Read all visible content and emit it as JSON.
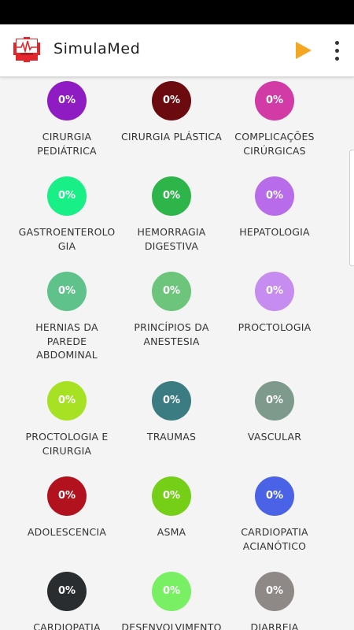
{
  "app": {
    "title": "SimulaMed"
  },
  "toolbar": {
    "play_icon": "play-icon",
    "menu_icon": "overflow-menu-icon"
  },
  "colors": {
    "accent": "#f5a623",
    "logo_red": "#e3262b"
  },
  "topics": [
    {
      "percent": "0%",
      "label": "CIRURGIA PEDIÁTRICA",
      "color": "#8e1cc2"
    },
    {
      "percent": "0%",
      "label": "CIRURGIA PLÁSTICA",
      "color": "#6b0a0f"
    },
    {
      "percent": "0%",
      "label": "COMPLICAÇÕES CIRÚRGICAS",
      "color": "#d23aa6"
    },
    {
      "percent": "0%",
      "label": "GASTROENTEROLOGIA",
      "color": "#18ef86"
    },
    {
      "percent": "0%",
      "label": "HEMORRAGIA DIGESTIVA",
      "color": "#2eb549"
    },
    {
      "percent": "0%",
      "label": "HEPATOLOGIA",
      "color": "#b86cea"
    },
    {
      "percent": "0%",
      "label": "HERNIAS DA PAREDE ABDOMINAL",
      "color": "#5ec28a"
    },
    {
      "percent": "0%",
      "label": "PRINCÍPIOS DA ANESTESIA",
      "color": "#6dc57c"
    },
    {
      "percent": "0%",
      "label": "PROCTOLOGIA",
      "color": "#c68cef"
    },
    {
      "percent": "0%",
      "label": "PROCTOLOGIA E CIRURGIA",
      "color": "#a6e123"
    },
    {
      "percent": "0%",
      "label": "TRAUMAS",
      "color": "#3b7c82"
    },
    {
      "percent": "0%",
      "label": "VASCULAR",
      "color": "#7d9a8c"
    },
    {
      "percent": "0%",
      "label": "ADOLESCENCIA",
      "color": "#b1121d"
    },
    {
      "percent": "0%",
      "label": "ASMA",
      "color": "#75cf17"
    },
    {
      "percent": "0%",
      "label": "CARDIOPATIA ACIANÓTICO",
      "color": "#4a63e6"
    },
    {
      "percent": "0%",
      "label": "CARDIOPATIA",
      "color": "#2a2d30"
    },
    {
      "percent": "0%",
      "label": "DESENVOLVIMENTO",
      "color": "#79ef64"
    },
    {
      "percent": "0%",
      "label": "DIARREIA",
      "color": "#8e8886"
    }
  ]
}
